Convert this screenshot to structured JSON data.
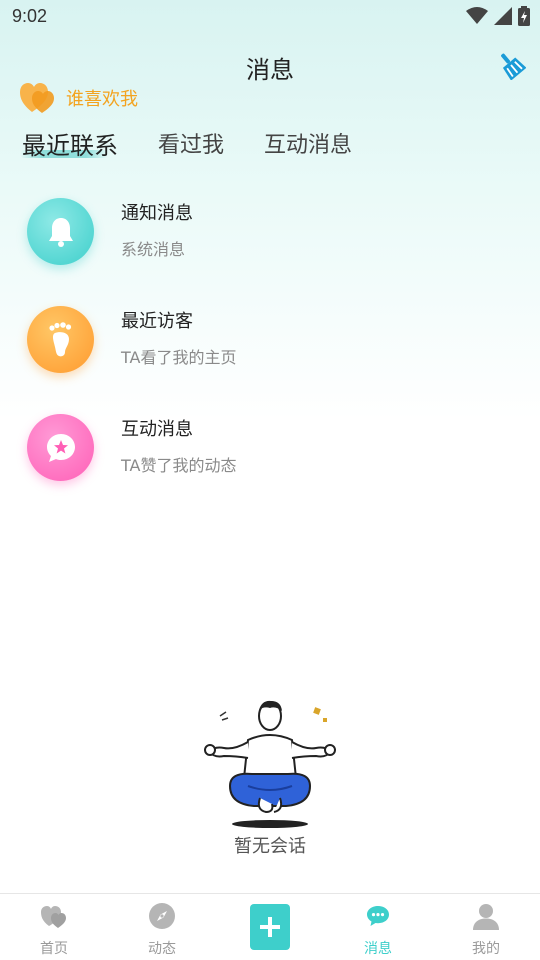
{
  "status_bar": {
    "time": "9:02"
  },
  "header": {
    "title": "消息",
    "clean_icon": "broom-icon"
  },
  "who_likes": {
    "label": "谁喜欢我",
    "icon": "hearts-icon",
    "color": "#f3a31f"
  },
  "tabs": [
    {
      "label": "最近联系",
      "active": true
    },
    {
      "label": "看过我",
      "active": false
    },
    {
      "label": "互动消息",
      "active": false
    }
  ],
  "messages": [
    {
      "title": "通知消息",
      "subtitle": "系统消息",
      "icon": "bell-icon",
      "color": "#3ecfcb"
    },
    {
      "title": "最近访客",
      "subtitle": "TA看了我的主页",
      "icon": "footprint-icon",
      "color": "#ff9a2e"
    },
    {
      "title": "互动消息",
      "subtitle": "TA赞了我的动态",
      "icon": "star-chat-icon",
      "color": "#ff5fb6"
    }
  ],
  "empty_state": {
    "text": "暂无会话",
    "illustration": "meditating-person-illustration"
  },
  "bottom_nav": [
    {
      "label": "首页",
      "icon": "home-hearts-icon",
      "active": false
    },
    {
      "label": "动态",
      "icon": "compass-icon",
      "active": false
    },
    {
      "label": "",
      "icon": "plus-icon",
      "active": false
    },
    {
      "label": "消息",
      "icon": "chat-bubble-icon",
      "active": true
    },
    {
      "label": "我的",
      "icon": "person-icon",
      "active": false
    }
  ],
  "accent_color": "#3ecfcb"
}
